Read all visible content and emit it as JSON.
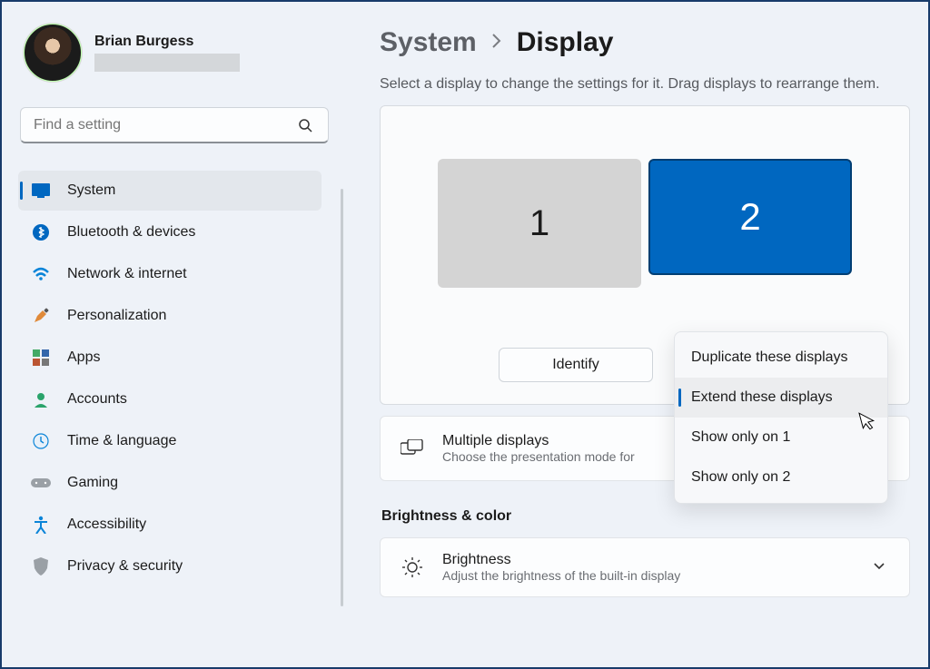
{
  "profile": {
    "name": "Brian Burgess"
  },
  "search": {
    "placeholder": "Find a setting"
  },
  "sidebar": {
    "items": [
      {
        "label": "System"
      },
      {
        "label": "Bluetooth & devices"
      },
      {
        "label": "Network & internet"
      },
      {
        "label": "Personalization"
      },
      {
        "label": "Apps"
      },
      {
        "label": "Accounts"
      },
      {
        "label": "Time & language"
      },
      {
        "label": "Gaming"
      },
      {
        "label": "Accessibility"
      },
      {
        "label": "Privacy & security"
      }
    ]
  },
  "breadcrumb": {
    "parent": "System",
    "current": "Display"
  },
  "help_text": "Select a display to change the settings for it. Drag displays to rearrange them.",
  "monitors": {
    "one": "1",
    "two": "2"
  },
  "identify_label": "Identify",
  "popup": {
    "options": [
      "Duplicate these displays",
      "Extend these displays",
      "Show only on 1",
      "Show only on 2"
    ],
    "selected_index": 1
  },
  "multiple_displays": {
    "title": "Multiple displays",
    "subtitle": "Choose the presentation mode for"
  },
  "section_brightness_title": "Brightness & color",
  "brightness": {
    "title": "Brightness",
    "subtitle": "Adjust the brightness of the built-in display"
  }
}
